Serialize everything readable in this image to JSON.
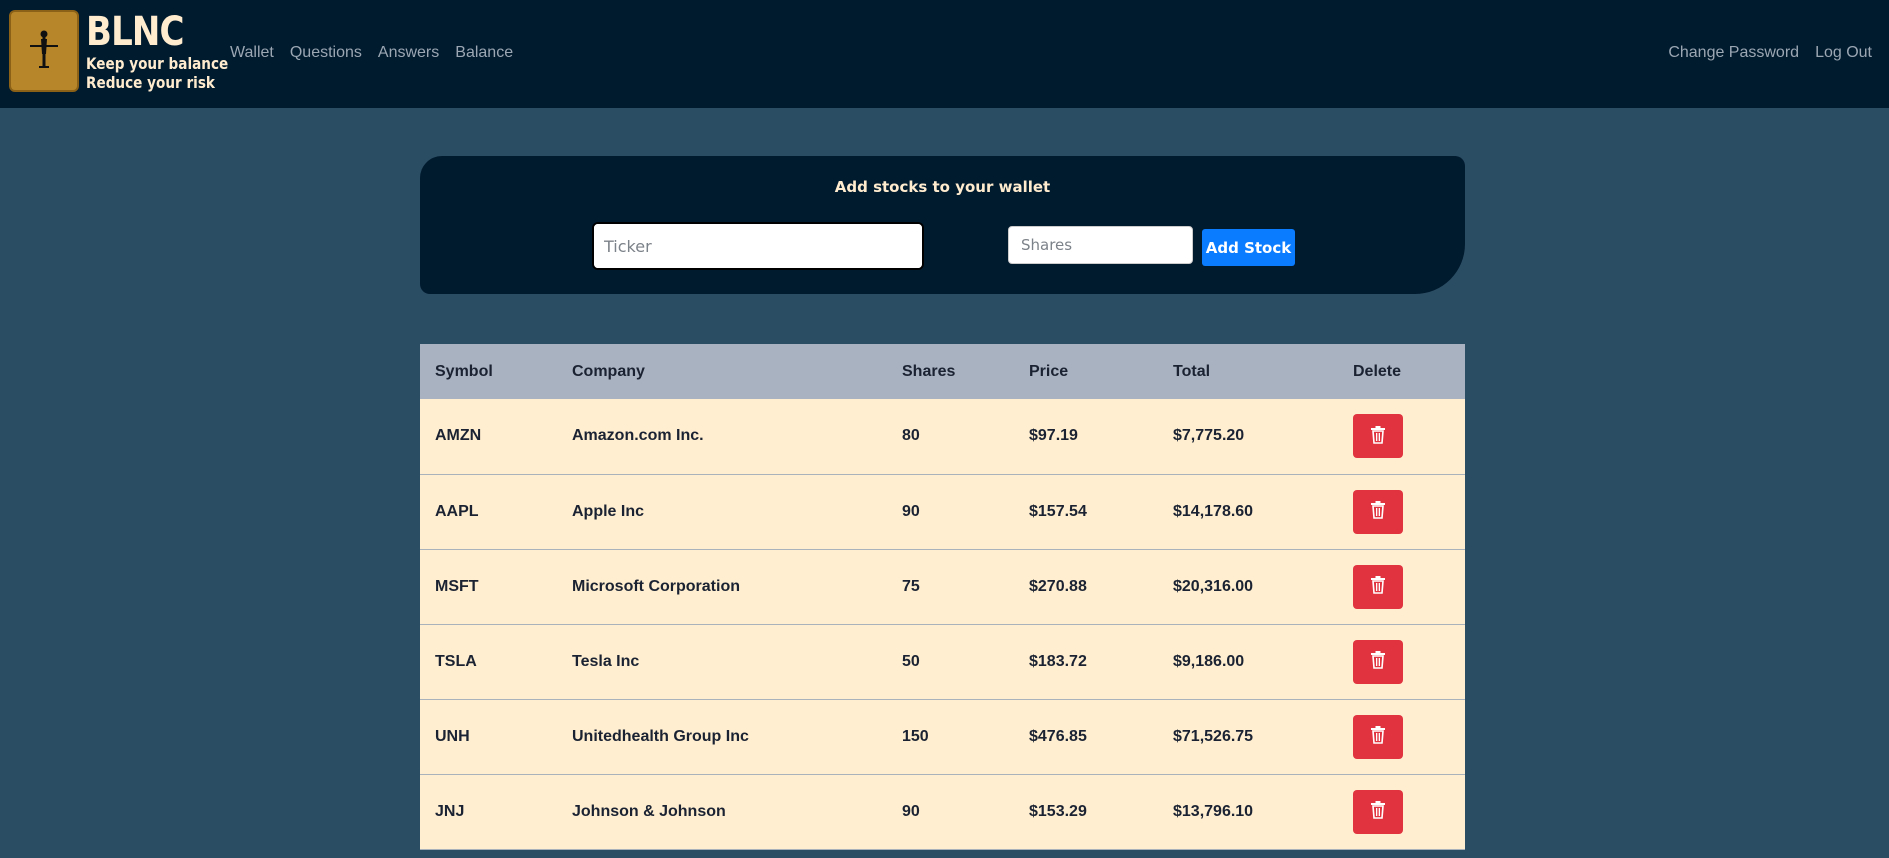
{
  "brand": {
    "title": "BLNC",
    "tagline1": "Keep your balance",
    "tagline2": "Reduce your risk"
  },
  "nav": {
    "left": [
      "Wallet",
      "Questions",
      "Answers",
      "Balance"
    ],
    "right": [
      "Change Password",
      "Log Out"
    ]
  },
  "add_form": {
    "title": "Add stocks to your wallet",
    "ticker_placeholder": "Ticker",
    "shares_placeholder": "Shares",
    "button_label": "Add Stock"
  },
  "table": {
    "headers": [
      "Symbol",
      "Company",
      "Shares",
      "Price",
      "Total",
      "Delete"
    ],
    "rows": [
      {
        "symbol": "AMZN",
        "company": "Amazon.com Inc.",
        "shares": "80",
        "price": "$97.19",
        "total": "$7,775.20"
      },
      {
        "symbol": "AAPL",
        "company": "Apple Inc",
        "shares": "90",
        "price": "$157.54",
        "total": "$14,178.60"
      },
      {
        "symbol": "MSFT",
        "company": "Microsoft Corporation",
        "shares": "75",
        "price": "$270.88",
        "total": "$20,316.00"
      },
      {
        "symbol": "TSLA",
        "company": "Tesla Inc",
        "shares": "50",
        "price": "$183.72",
        "total": "$9,186.00"
      },
      {
        "symbol": "UNH",
        "company": "Unitedhealth Group Inc",
        "shares": "150",
        "price": "$476.85",
        "total": "$71,526.75"
      },
      {
        "symbol": "JNJ",
        "company": "Johnson & Johnson",
        "shares": "90",
        "price": "$153.29",
        "total": "$13,796.10"
      }
    ]
  },
  "icons": {
    "logo": "balance-figure-icon",
    "delete": "trash-icon"
  },
  "colors": {
    "navbar": "#001a2e",
    "page_bg": "#2b4d63",
    "logo_bg": "#b8862a",
    "brand_text": "#ffeccf",
    "add_button": "#0a7cff",
    "delete_button": "#e0333f",
    "table_header": "#a8b2c0",
    "table_row": "#ffeecf"
  }
}
